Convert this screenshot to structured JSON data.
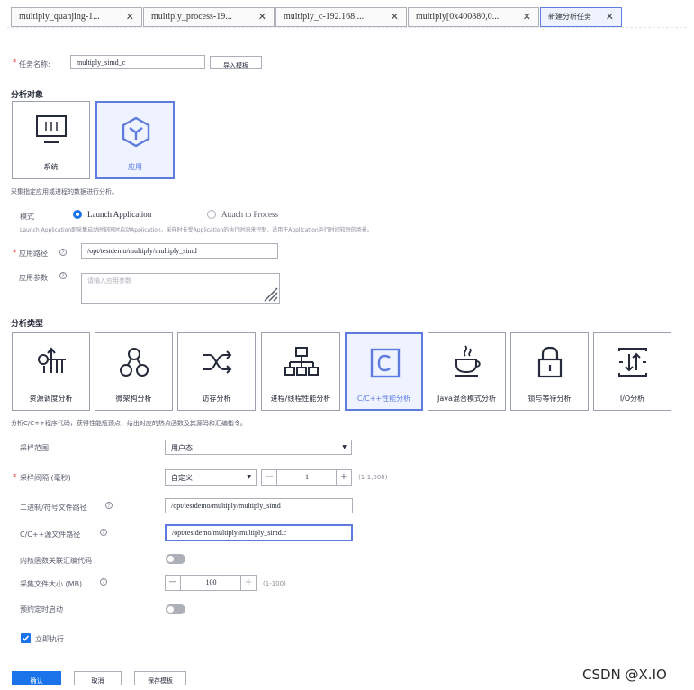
{
  "tabs": [
    {
      "label": "multiply_quanjing-1..."
    },
    {
      "label": "multiply_process-19..."
    },
    {
      "label": "multiply_c-192.168...."
    },
    {
      "label": "multiply[0x400880,0..."
    },
    {
      "label": "新建分析任务"
    }
  ],
  "task": {
    "label": "任务名称:",
    "value": "multiply_simd_c",
    "import_button": "导入模板"
  },
  "analysis_object": {
    "title": "分析对象",
    "cards": [
      {
        "label": "系统",
        "icon": "monitor-icon"
      },
      {
        "label": "应用",
        "icon": "cube-icon"
      }
    ],
    "description": "采集指定应用或进程的数据进行分析。"
  },
  "mode": {
    "label": "模式",
    "options": [
      {
        "label": "Launch Application",
        "selected": true
      },
      {
        "label": "Attach to Process",
        "selected": false
      }
    ],
    "note": "Launch Application即采集启动时刻同时启动Application，采样时长受Application的执行时间来控制，适用于Application运行时间较短的场景。"
  },
  "app_path": {
    "label": "应用路径",
    "value": "/opt/testdemo/multiply/multiply_simd"
  },
  "app_params": {
    "label": "应用参数",
    "placeholder": "请输入应用参数"
  },
  "analysis_type": {
    "title": "分析类型",
    "cards": [
      {
        "label": "资源调度分析",
        "icon": "resource-schedule-icon"
      },
      {
        "label": "微架构分析",
        "icon": "microarch-icon"
      },
      {
        "label": "访存分析",
        "icon": "memory-access-icon"
      },
      {
        "label": "进程/线程性能分析",
        "icon": "process-thread-icon"
      },
      {
        "label": "C/C++性能分析",
        "icon": "c-language-icon"
      },
      {
        "label": "Java混合模式分析",
        "icon": "java-icon"
      },
      {
        "label": "锁与等待分析",
        "icon": "lock-icon"
      },
      {
        "label": "I/O分析",
        "icon": "io-icon"
      }
    ],
    "description": "分析C/C++程序代码，获得性能瓶颈点，给出对应的热点函数及其源码和汇编指令。"
  },
  "form": {
    "sample_range": {
      "label": "采样范围",
      "value": "用户态"
    },
    "sample_interval": {
      "label": "采样间隔 (毫秒)",
      "mode_value": "自定义",
      "minus": "—",
      "value": "1",
      "plus": "+",
      "range_hint": "(1-1,000)"
    },
    "binary_path": {
      "label": "二进制/符号文件路径",
      "value": "/opt/testdemo/multiply/multiply_simd"
    },
    "source_path": {
      "label": "C/C++源文件路径",
      "value": "/opt/testdemo/multiply/multiply_simd.c"
    },
    "inline_asm": {
      "label": "内核函数关联汇编代码",
      "enabled": false
    },
    "file_size": {
      "label": "采集文件大小 (MB)",
      "minus": "—",
      "value": "100",
      "plus": "+",
      "range_hint": "(1-100)"
    },
    "scheduled": {
      "label": "预约定时启动",
      "enabled": false
    },
    "execute_now": {
      "label": "立即执行",
      "checked": true
    }
  },
  "actions": {
    "confirm": "确认",
    "cancel": "取消",
    "save_template": "保存模板"
  },
  "watermark": "CSDN @X.IO",
  "colors": {
    "accent": "#5e7ce0",
    "primary_button": "#1a73e8",
    "required": "#e54545"
  }
}
